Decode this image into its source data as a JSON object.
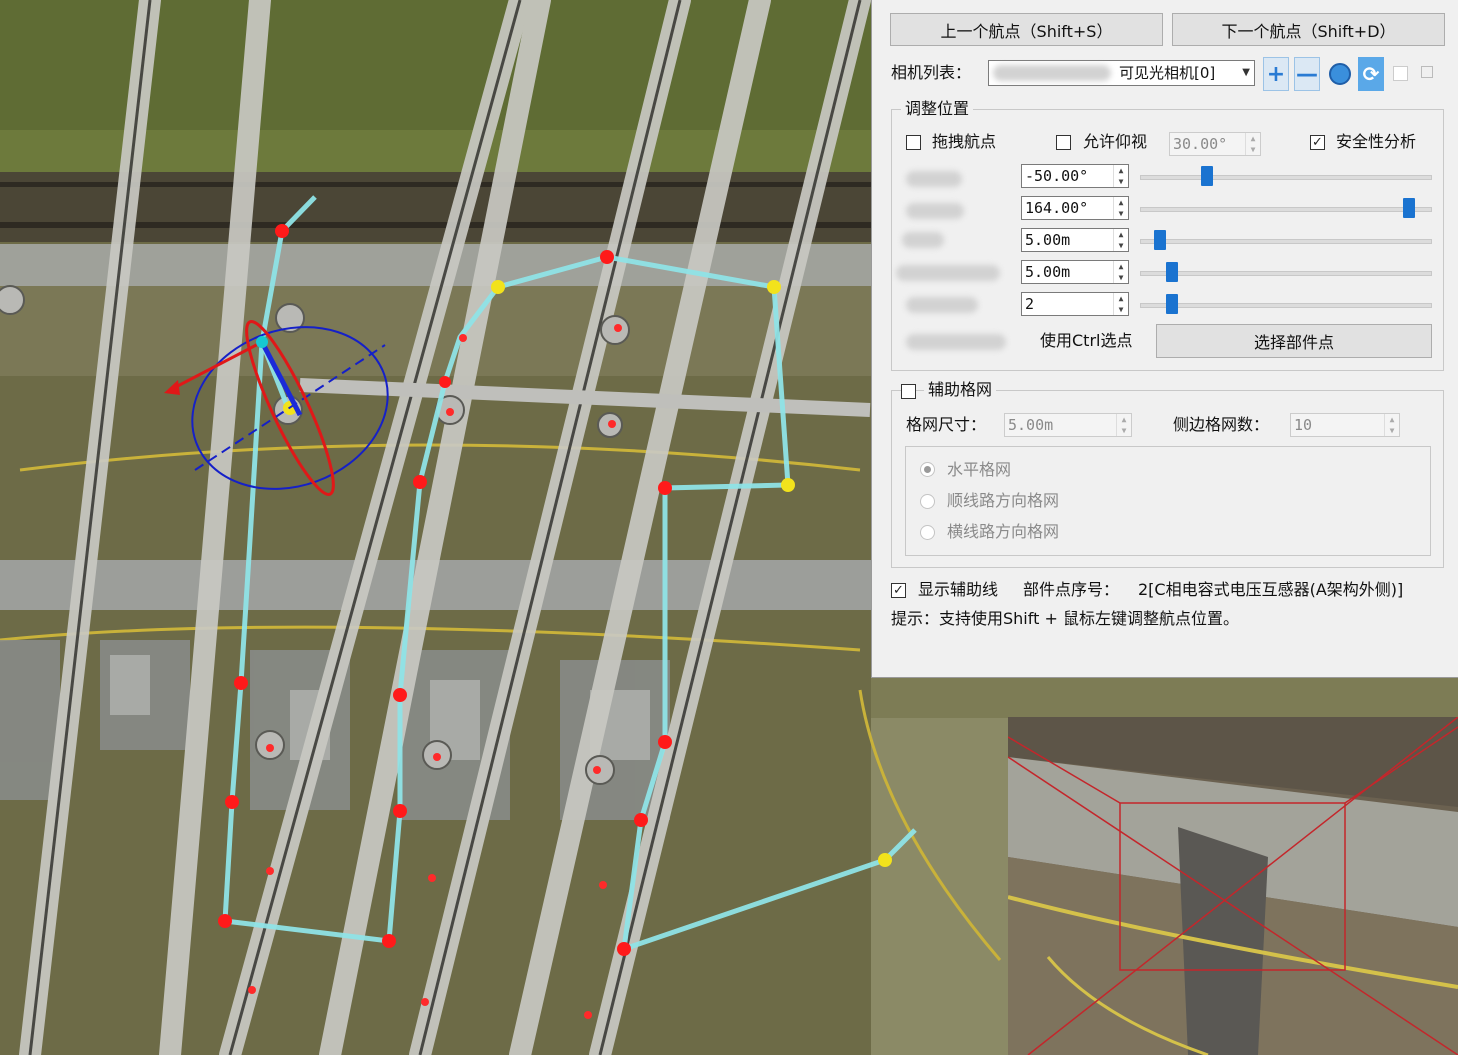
{
  "nav": {
    "prev_label": "上一个航点（Shift+S）",
    "next_label": "下一个航点（Shift+D）"
  },
  "camera": {
    "label": "相机列表：",
    "selected": "可见光相机[0]",
    "add_icon": "plus-icon",
    "remove_icon": "minus-icon",
    "refresh_icon": "refresh-icon",
    "sync_icon": "sync-icon"
  },
  "adjust": {
    "title": "调整位置",
    "drag_label": "拖拽航点",
    "drag_checked": false,
    "allow_up_label": "允许仰视",
    "allow_up_checked": false,
    "up_angle": "30.00°",
    "safety_label": "安全性分析",
    "safety_checked": true,
    "rows": [
      {
        "value": "-50.00°",
        "slider": 0.23
      },
      {
        "value": "164.00°",
        "slider": 0.92
      },
      {
        "value": "5.00m",
        "slider": 0.07
      },
      {
        "value": "5.00m",
        "slider": 0.11
      },
      {
        "value": "2",
        "slider": 0.11
      }
    ],
    "ctrl_label": "使用Ctrl选点",
    "select_part_label": "选择部件点"
  },
  "grid": {
    "title": "辅助格网",
    "checked": false,
    "size_label": "格网尺寸：",
    "size_value": "5.00m",
    "count_label": "侧边格网数：",
    "count_value": "10",
    "options": [
      "水平格网",
      "顺线路方向格网",
      "横线路方向格网"
    ],
    "selected_index": 0
  },
  "footer": {
    "show_aux_label": "显示辅助线",
    "show_aux_checked": true,
    "part_label": "部件点序号：",
    "part_value": "2[C相电容式电压互感器(A架构外侧)]",
    "hint": "提示：支持使用Shift + 鼠标左键调整航点位置。"
  },
  "colors": {
    "route": "#8fe3e6",
    "waypoint": "#ff1a1a",
    "waypoint_key": "#f2e21c",
    "accent": "#1a73d0"
  }
}
